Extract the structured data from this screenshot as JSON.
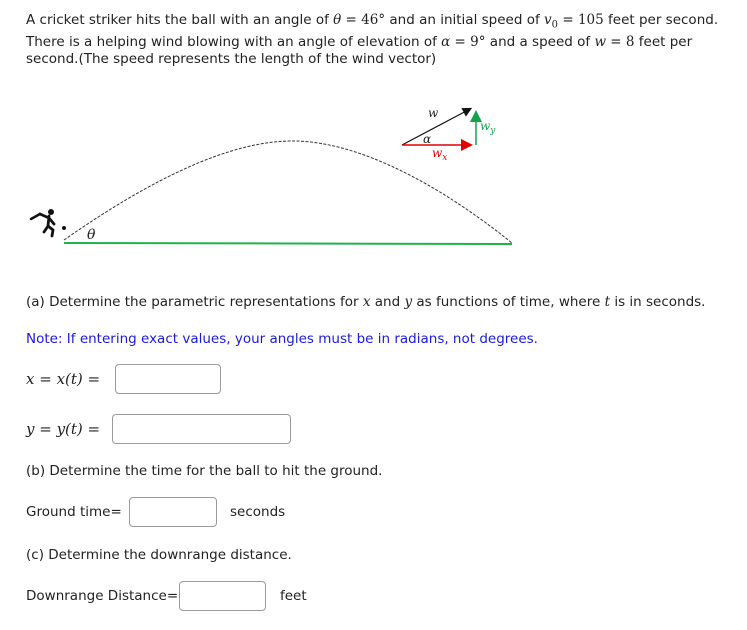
{
  "problem": {
    "line1_pre": "A cricket striker hits the ball with an angle of ",
    "theta_sym": "θ",
    "eq": " = ",
    "theta_val": "46°",
    "line1_mid": " and an initial speed of ",
    "v0_sym": "v",
    "v0_sub": "0",
    "v0_val": "105",
    "line1_post": " feet per second.",
    "line2_pre": "There is a helping wind blowing with an angle of elevation of ",
    "alpha_sym": "α",
    "alpha_val": "9°",
    "line2_mid": " and a speed of ",
    "w_sym": "w",
    "w_val": "8",
    "line2_post": " feet per",
    "line3": "second.(The speed represents the length of the wind vector)"
  },
  "figure": {
    "theta_label": "θ",
    "w_label": "w",
    "alpha_label": "α",
    "wx_label": "w",
    "wx_sub": "x",
    "wy_label": "w",
    "wy_sub": "y",
    "colors": {
      "ground": "#22b14c",
      "wx": "#e00000",
      "wy": "#15a34a",
      "w": "#111111",
      "trajectory": "#333333"
    }
  },
  "part_a": {
    "pre": "(a) Determine the parametric representations for ",
    "x": "x",
    "and": " and ",
    "y": "y",
    "mid": " as functions of time, where ",
    "t": "t",
    "post": " is in seconds.",
    "note": "Note: If entering exact values, your angles must be in radians, not degrees.",
    "x_label": "x = x(t) =",
    "y_label": "y = y(t) =",
    "x_value": "",
    "y_value": ""
  },
  "part_b": {
    "question": "(b) Determine the time for the ball to hit the ground.",
    "label": "Ground time=",
    "value": "",
    "unit": "seconds"
  },
  "part_c": {
    "question": "(c) Determine the downrange distance.",
    "label": "Downrange Distance=",
    "value": "",
    "unit": "feet"
  }
}
